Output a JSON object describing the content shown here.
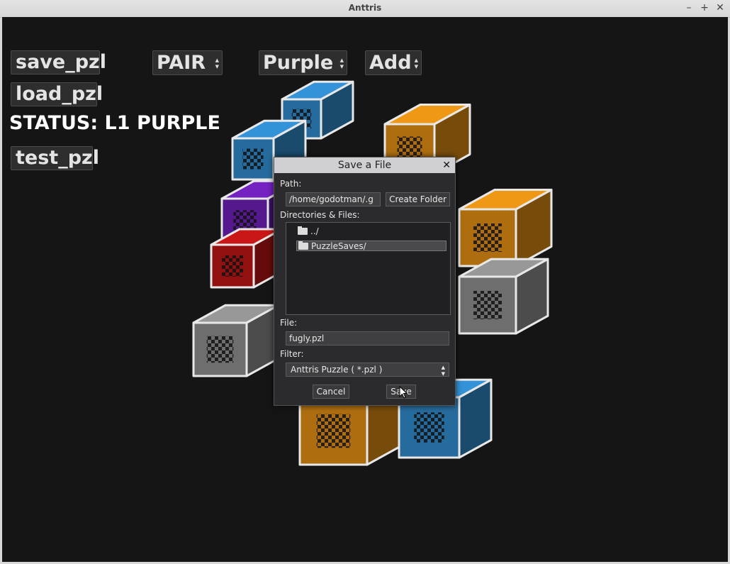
{
  "window": {
    "title": "Anttris",
    "controls": [
      "–",
      "+",
      "✕"
    ]
  },
  "game_ui": {
    "save_button": "save_pzl",
    "load_button": "load_pzl",
    "test_button": "test_pzl",
    "mode_select": "PAIR",
    "color_select": "Purple",
    "action_select": "Add",
    "status": "STATUS: L1 PURPLE"
  },
  "dialog": {
    "title": "Save a File",
    "close": "✕",
    "path_label": "Path:",
    "path_value": "/home/godotman/.g",
    "create_folder": "Create Folder",
    "files_label": "Directories & Files:",
    "items": [
      {
        "label": "../",
        "icon": "folder-icon",
        "selected": false
      },
      {
        "label": "PuzzleSaves/",
        "icon": "folder-icon",
        "selected": true
      }
    ],
    "file_label": "File:",
    "file_value": "fugly.pzl",
    "filter_label": "Filter:",
    "filter_value": "Anttris Puzzle ( *.pzl )",
    "cancel": "Cancel",
    "save": "Save"
  },
  "colors": {
    "background": "#151515",
    "orange": "#d98a14",
    "blue": "#2f86c4",
    "purple": "#6a1fb0",
    "red": "#b81414",
    "grey": "#8a8a8a"
  }
}
